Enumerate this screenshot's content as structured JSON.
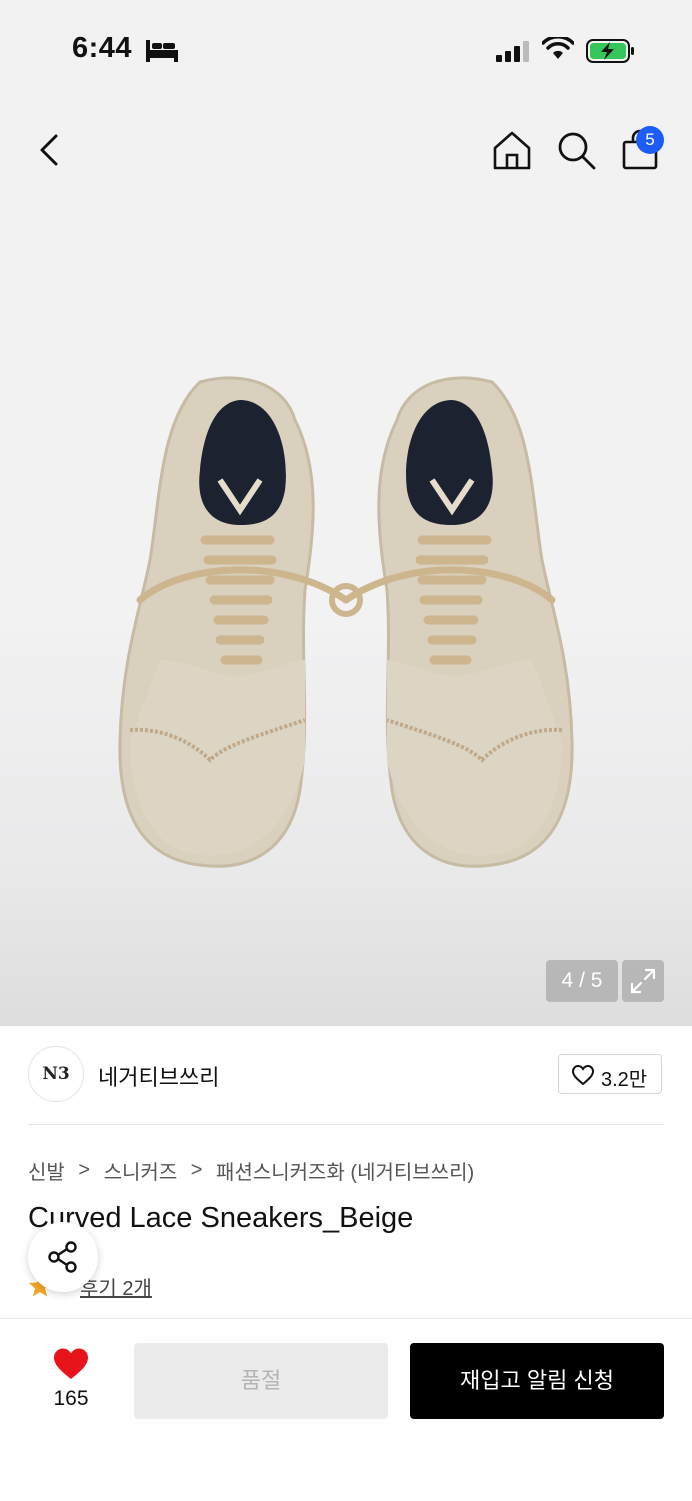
{
  "status_bar": {
    "time": "6:44",
    "icons": [
      "bed-icon",
      "cellular-signal-icon",
      "wifi-icon",
      "battery-charging-icon"
    ],
    "battery_color": "#34c759"
  },
  "nav": {
    "icons": [
      "back-chevron-icon",
      "home-icon",
      "search-icon",
      "shopping-bag-icon"
    ],
    "cart_count": "5",
    "badge_color": "#1d5cf6"
  },
  "gallery": {
    "current": "4",
    "separator": " / ",
    "total": "5",
    "expand_icon": "expand-icon"
  },
  "brand": {
    "logo_text": "N3",
    "name": "네거티브쓰리",
    "like_count": "3.2만"
  },
  "breadcrumb": {
    "items": [
      "신발",
      "스니커즈",
      "패션스니커즈화 (네거티브쓰리)"
    ],
    "separator": ">"
  },
  "product": {
    "title": "Curved Lace Sneakers_Beige",
    "rating": "5",
    "reviews_label": "후기 2개",
    "rating_star_color": "#f5a623"
  },
  "bottom_bar": {
    "wish_count": "165",
    "wish_color": "#e8141c",
    "soldout_label": "품절",
    "restock_label": "재입고 알림 신청"
  }
}
